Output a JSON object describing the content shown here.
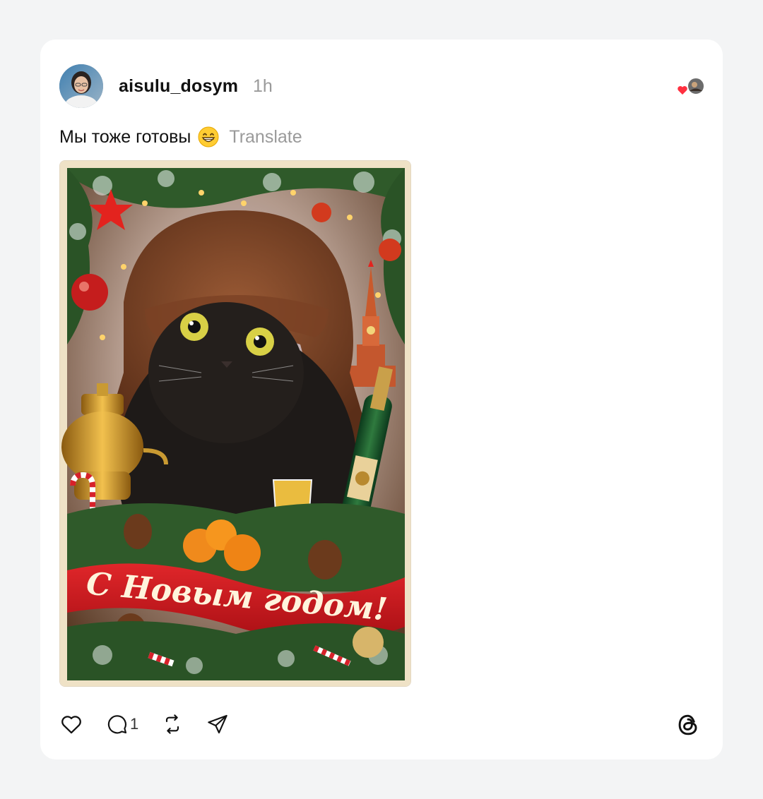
{
  "post": {
    "author": {
      "username": "aisulu_dosym",
      "avatar_icon": "avatar-photo"
    },
    "time_ago": "1h",
    "caption": {
      "text": "Мы тоже готовы",
      "emoji": "grinning-face-emoji",
      "translate_label": "Translate"
    },
    "image": {
      "banner_text": "С Новым годом!",
      "description_icon": "new-year-card-image"
    },
    "actions": {
      "like_icon": "heart-icon",
      "reply_icon": "comment-icon",
      "reply_count": "1",
      "repost_icon": "repost-icon",
      "share_icon": "send-icon"
    },
    "liked_by_icon": "heart-badge-icon"
  },
  "colors": {
    "background": "#f3f4f5",
    "card": "#ffffff",
    "muted_text": "#9a9a9a",
    "heart_red": "#ff3040",
    "banner_red": "#c8171c"
  }
}
